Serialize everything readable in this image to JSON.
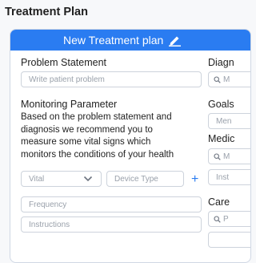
{
  "page": {
    "title": "Treatment Plan"
  },
  "header": {
    "title": "New Treatment plan",
    "edit_icon": "pencil-icon"
  },
  "left": {
    "problem_statement": {
      "label": "Problem Statement",
      "placeholder": "Write patient problem"
    },
    "monitoring": {
      "label": "Monitoring Parameter",
      "description": "Based on the problem statement and diagnosis we recommend you to measure some vital signs which monitors the conditions of your health"
    },
    "vital_select": {
      "value": "Vital",
      "icon": "chevron-down-icon"
    },
    "device_type": {
      "placeholder": "Device Type"
    },
    "add_icon": "+",
    "frequency": {
      "placeholder": "Frequency"
    },
    "instructions": {
      "placeholder": "Instructions"
    }
  },
  "right": {
    "diagnosis": {
      "label": "Diagn",
      "field_text": "M"
    },
    "goals": {
      "label": "Goals",
      "field_text": "Men"
    },
    "medication": {
      "label": "Medic",
      "field1_text": "M",
      "field2_text": "Inst"
    },
    "care": {
      "label": "Care",
      "field_text": "P"
    }
  },
  "colors": {
    "accent": "#2a7cf1",
    "background": "#f7f8fa",
    "border": "#cdd3dc"
  }
}
